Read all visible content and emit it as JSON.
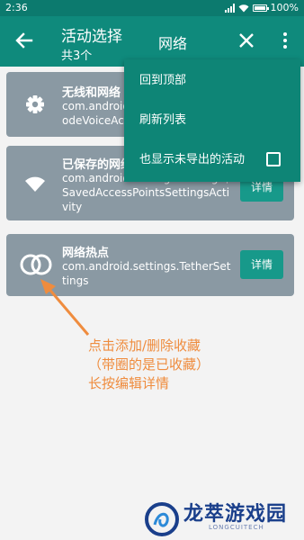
{
  "status_bar": {
    "time": "2:36",
    "battery": "100%"
  },
  "app_bar": {
    "title": "活动选择",
    "subtitle": "共3个",
    "search_query": "网络"
  },
  "cards": [
    {
      "name": "无线和网络",
      "package": "com.android.settings.Settings$WirelessSettingsActivity",
      "package_lines": [
        "com.android",
        "odeVoiceActi"
      ]
    },
    {
      "name": "已保存的网络",
      "package": "com.android.settings.Settings$SavedAccessPointsSettingsActivity",
      "package_lines": [
        "com.android.settings.Settings$",
        "SavedAccessPointsSettingsActi",
        "vity"
      ]
    },
    {
      "name": "网络热点",
      "package": "com.android.settings.TetherSettings",
      "package_lines": [
        "com.android.settings.TetherSet",
        "tings"
      ]
    }
  ],
  "detail_label": "详情",
  "overflow_menu": {
    "items": [
      "回到顶部",
      "刷新列表",
      "也显示未导出的活动"
    ],
    "show_unexported_checked": false
  },
  "annotation": {
    "lines": [
      "点击添加/删除收藏",
      "（带圈的是已收藏）",
      "长按编辑详情"
    ]
  },
  "watermark": {
    "title": "龙萃游戏园",
    "subtitle": "LONGCUITECH"
  },
  "colors": {
    "primary": "#0f8a7c",
    "status_bar": "#0c7a6e",
    "card": "#8a99a3",
    "accent_button": "#17998a",
    "annotation": "#ef8c3e"
  }
}
